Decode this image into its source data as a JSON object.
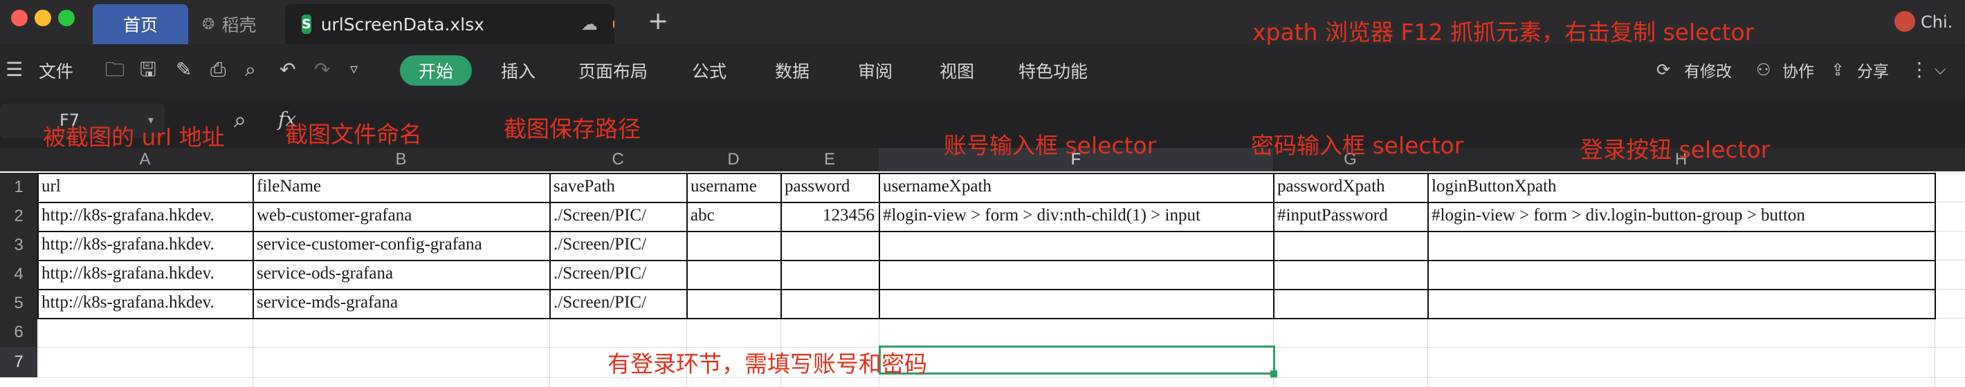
{
  "tabs": {
    "home": "首页",
    "daoke": "稻壳",
    "file": "urlScreenData.xlsx",
    "user": "Chi."
  },
  "menu": {
    "file": "文件",
    "start": "开始",
    "insert": "插入",
    "layout": "页面布局",
    "formula": "公式",
    "data": "数据",
    "review": "审阅",
    "view": "视图",
    "special": "特色功能",
    "modified": "有修改",
    "collab": "协作",
    "share": "分享"
  },
  "formula_bar": {
    "name_box": "F7",
    "fx": "fx"
  },
  "columns": [
    "A",
    "B",
    "C",
    "D",
    "E",
    "F",
    "G",
    "H"
  ],
  "rows": [
    "1",
    "2",
    "3",
    "4",
    "5",
    "6",
    "7"
  ],
  "table": {
    "header": [
      "url",
      "fileName",
      "savePath",
      "username",
      "password",
      "usernameXpath",
      "passwordXpath",
      "loginButtonXpath"
    ],
    "rows": [
      [
        "http://k8s-grafana.hkdev.",
        "web-customer-grafana",
        "./Screen/PIC/",
        "abc",
        "123456",
        "#login-view > form > div:nth-child(1) > input",
        "#inputPassword",
        "#login-view > form > div.login-button-group > button"
      ],
      [
        "http://k8s-grafana.hkdev.",
        "service-customer-config-grafana",
        "./Screen/PIC/",
        "",
        "",
        "",
        "",
        ""
      ],
      [
        "http://k8s-grafana.hkdev.",
        "service-ods-grafana",
        "./Screen/PIC/",
        "",
        "",
        "",
        "",
        ""
      ],
      [
        "http://k8s-grafana.hkdev.",
        "service-mds-grafana",
        "./Screen/PIC/",
        "",
        "",
        "",
        "",
        ""
      ]
    ]
  },
  "annotations": {
    "top": "xpath 浏览器 F12 抓抓元素，右击复制 selector",
    "url": "被截图的 url 地址",
    "filename": "截图文件命名",
    "savepath": "截图保存路径",
    "user_sel": "账号输入框 selector",
    "pass_sel": "密码输入框 selector",
    "btn_sel": "登录按钮 selector",
    "login_note": "有登录环节，需填写账号和密码"
  },
  "colors": {
    "accent_green": "#2e9e6a",
    "annotation_red": "#e0321e",
    "tab_blue": "#3c5ea8"
  }
}
